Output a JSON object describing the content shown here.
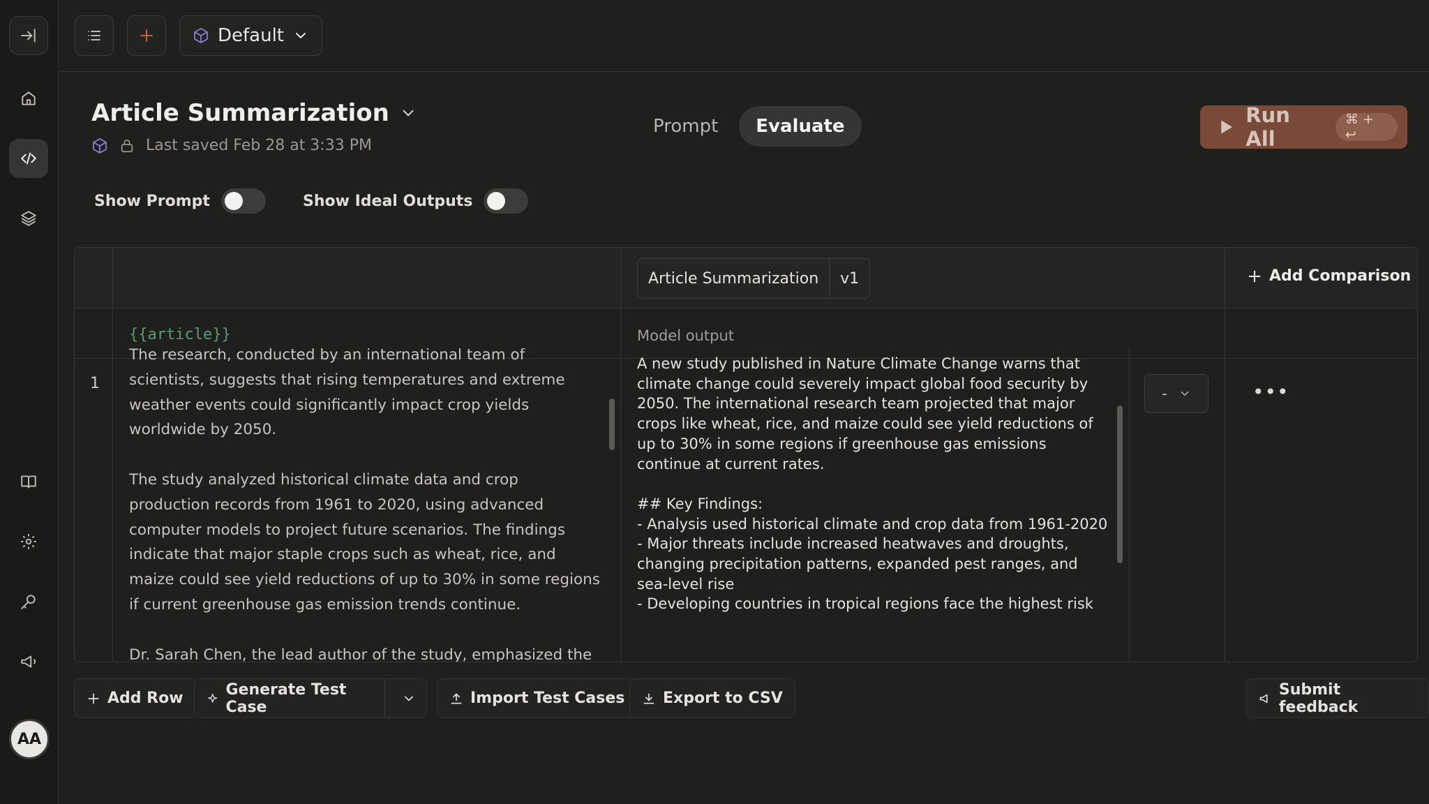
{
  "topbar": {
    "project_name": "Default"
  },
  "header": {
    "title": "Article Summarization",
    "saved": "Last saved Feb 28 at 3:33 PM",
    "tabs": [
      "Prompt",
      "Evaluate"
    ],
    "active_tab": "Evaluate",
    "run_all_label": "Run All",
    "run_all_shortcut": "⌘ + ↩"
  },
  "toggles": {
    "show_prompt_label": "Show Prompt",
    "show_ideal_outputs_label": "Show Ideal Outputs"
  },
  "table": {
    "prompt_name": "Article Summarization",
    "prompt_version": "v1",
    "add_comparison_label": "Add Comparison",
    "variable_header": "{{article}}",
    "output_header": "Model output",
    "rows": [
      {
        "index": "1",
        "article": "The research, conducted by an international team of scientists, suggests that rising temperatures and extreme weather events could significantly impact crop yields worldwide by 2050.\n\nThe study analyzed historical climate data and crop production records from 1961 to 2020, using advanced computer models to project future scenarios. The findings indicate that major staple crops such as wheat, rice, and maize could see yield reductions of up to 30% in some regions if current greenhouse gas emission trends continue.\n\nDr. Sarah Chen, the lead author of the study, emphasized the",
        "output": "A new study published in Nature Climate Change warns that climate change could severely impact global food security by 2050. The international research team projected that major crops like wheat, rice, and maize could see yield reductions of up to 30% in some regions if greenhouse gas emissions continue at current rates.\n\n## Key Findings:\n- Analysis used historical climate and crop data from 1961-2020\n- Major threats include increased heatwaves and droughts, changing precipitation patterns, expanded pest ranges, and sea-level rise\n- Developing countries in tropical regions face the highest risk",
        "rating": "-",
        "more": "•••"
      }
    ]
  },
  "bottom": {
    "add_row": "Add Row",
    "generate_test_case": "Generate Test Case",
    "import_test_cases": "Import Test Cases",
    "export_csv": "Export to CSV",
    "submit_feedback": "Submit feedback"
  },
  "user": {
    "initials": "AA"
  },
  "colors": {
    "accent_run": "#7a4a38",
    "variable_green": "#5c9a6c",
    "background": "#1f1f1e"
  }
}
